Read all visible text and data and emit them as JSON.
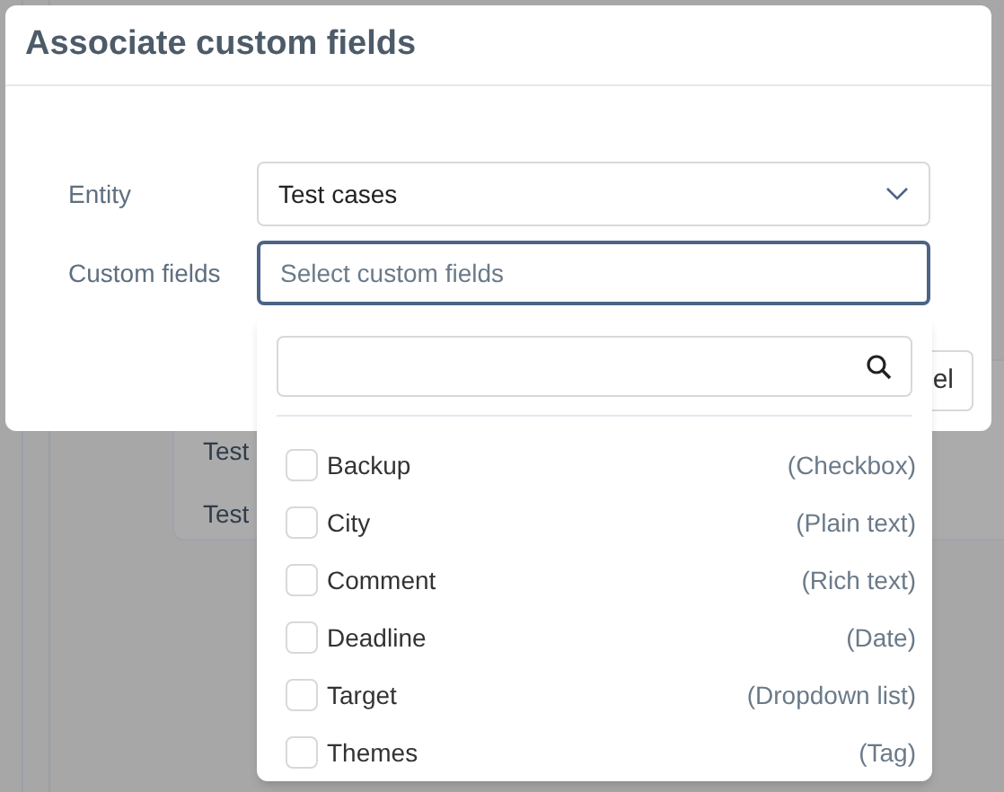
{
  "background": {
    "rows": [
      "Test",
      "Test"
    ],
    "button": "el"
  },
  "dialog": {
    "title": "Associate custom fields",
    "fields": [
      {
        "label": "Entity",
        "kind": "select",
        "value": "Test cases"
      },
      {
        "label": "Custom fields",
        "kind": "multiselect",
        "placeholder": "Select custom fields",
        "focused": true
      }
    ]
  },
  "dropdown": {
    "options": [
      {
        "label": "Backup",
        "type": "(Checkbox)",
        "checked": false
      },
      {
        "label": "City",
        "type": "(Plain text)",
        "checked": false
      },
      {
        "label": "Comment",
        "type": "(Rich text)",
        "checked": false
      },
      {
        "label": "Deadline",
        "type": "(Date)",
        "checked": false
      },
      {
        "label": "Target",
        "type": "(Dropdown list)",
        "checked": false
      },
      {
        "label": "Themes",
        "type": "(Tag)",
        "checked": false
      }
    ]
  }
}
